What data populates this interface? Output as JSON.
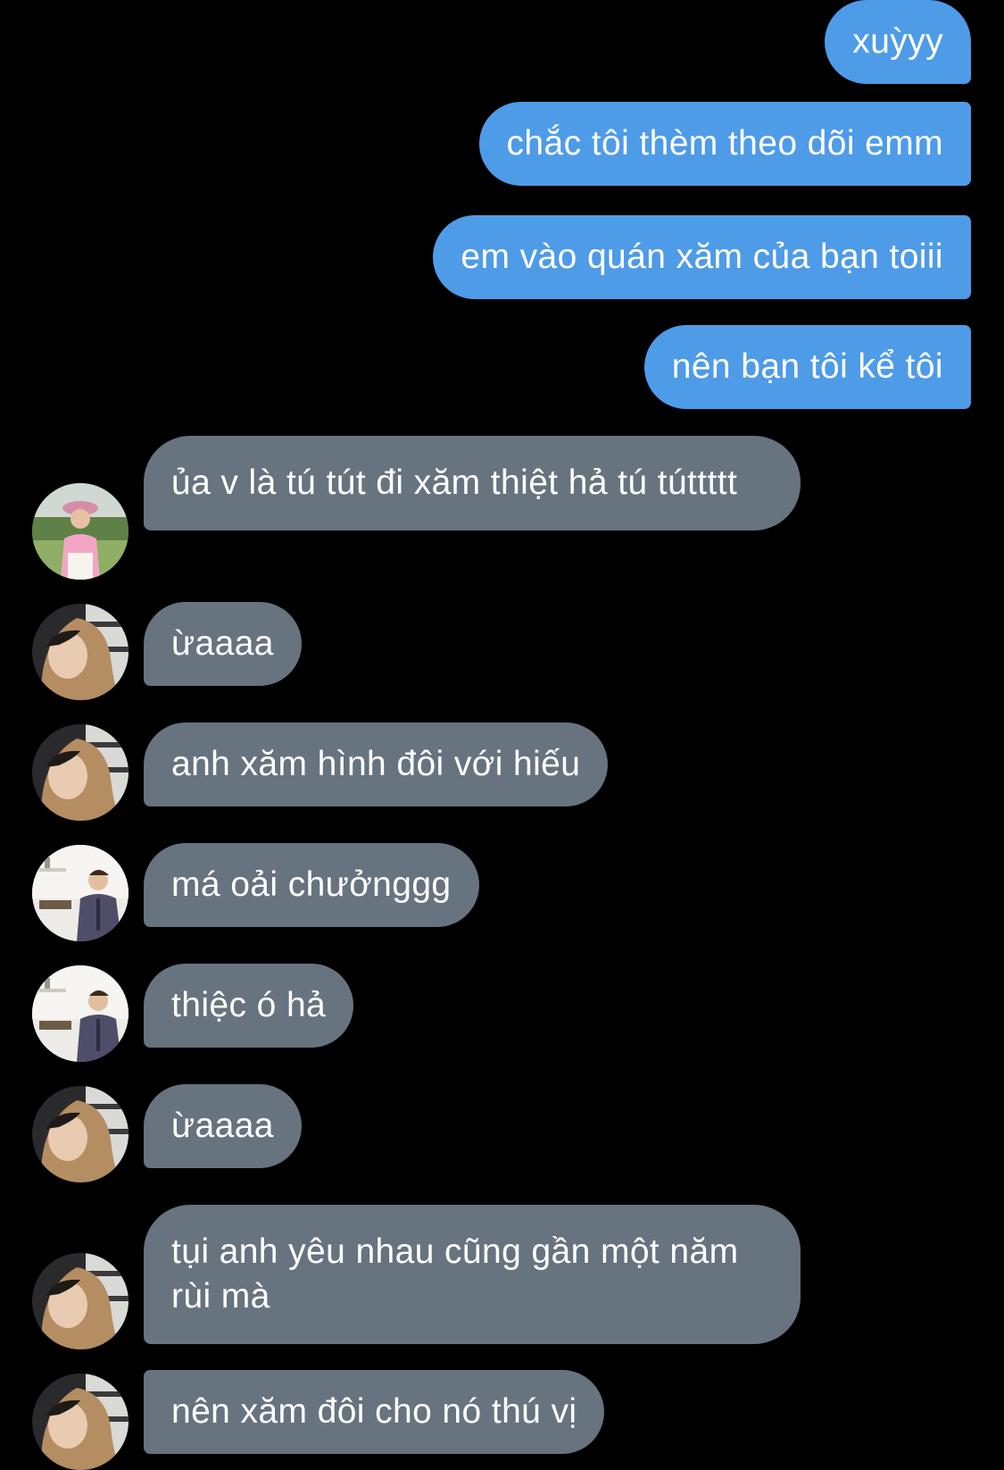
{
  "colors": {
    "background": "#000000",
    "outgoing_bubble": "#4e9be8",
    "incoming_bubble": "#67737f",
    "text": "#ffffff"
  },
  "messages": [
    {
      "direction": "outgoing",
      "text": "xuỳyy"
    },
    {
      "direction": "outgoing",
      "text": "chắc tôi thèm theo dõi emm"
    },
    {
      "direction": "outgoing",
      "text": "em vào quán xăm của bạn toiii"
    },
    {
      "direction": "outgoing",
      "text": "nên bạn tôi kể tôi"
    },
    {
      "direction": "incoming",
      "sender_avatar": "pink-shirt-avatar",
      "text": "ủa v là tú tút đi xăm thiệt hả tú túttttt"
    },
    {
      "direction": "incoming",
      "sender_avatar": "hoodie-avatar",
      "text": "ừaaaa"
    },
    {
      "direction": "incoming",
      "sender_avatar": "hoodie-avatar",
      "text": "anh xăm hình đôi với hiếu"
    },
    {
      "direction": "incoming",
      "sender_avatar": "jacket-avatar",
      "text": "má oải chưởnggg"
    },
    {
      "direction": "incoming",
      "sender_avatar": "jacket-avatar",
      "text": "thiệc ó hả"
    },
    {
      "direction": "incoming",
      "sender_avatar": "hoodie-avatar",
      "text": "ừaaaa"
    },
    {
      "direction": "incoming",
      "sender_avatar": "hoodie-avatar",
      "text": "tụi anh yêu nhau cũng gần một năm rùi mà"
    },
    {
      "direction": "incoming",
      "sender_avatar": "hoodie-avatar",
      "text": "nên xăm đôi cho nó thú vị"
    }
  ]
}
